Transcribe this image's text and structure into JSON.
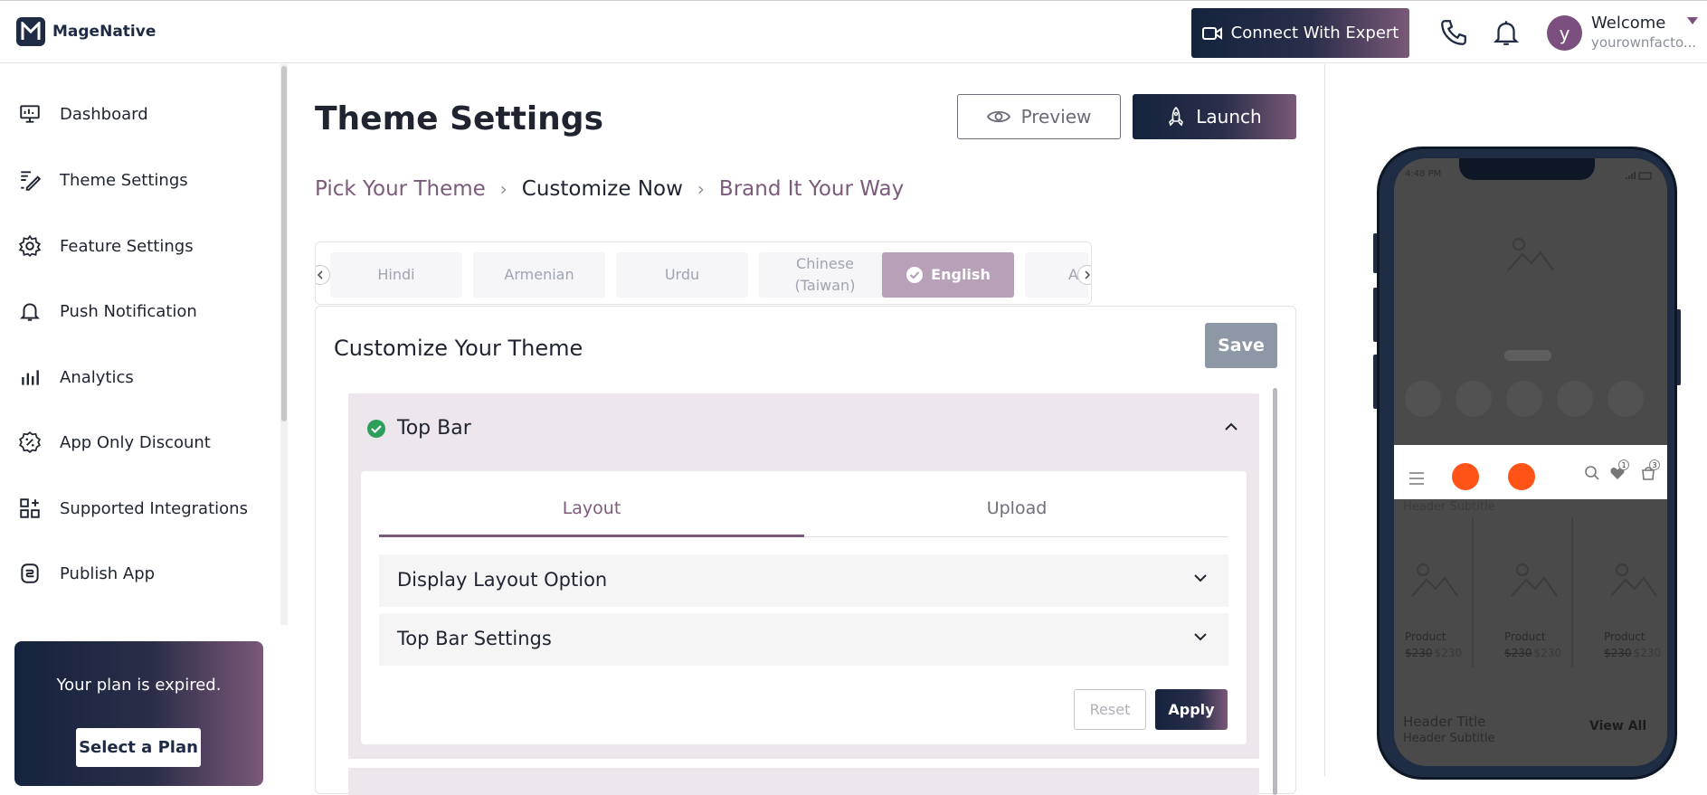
{
  "brand": {
    "name": "MageNative"
  },
  "topbar": {
    "expert_label": "Connect With Expert",
    "welcome": "Welcome",
    "user": "yourownfacto...",
    "avatar_letter": "y"
  },
  "sidebar": {
    "items": [
      {
        "label": "Dashboard",
        "icon": "dashboard-icon"
      },
      {
        "label": "Theme Settings",
        "icon": "theme-icon"
      },
      {
        "label": "Feature Settings",
        "icon": "gear-icon"
      },
      {
        "label": "Push Notification",
        "icon": "bell-icon"
      },
      {
        "label": "Analytics",
        "icon": "analytics-icon"
      },
      {
        "label": "App Only Discount",
        "icon": "discount-icon"
      },
      {
        "label": "Supported Integrations",
        "icon": "integrations-icon"
      },
      {
        "label": "Publish App",
        "icon": "publish-icon"
      }
    ],
    "plan": {
      "text": "Your plan is expired.",
      "button": "Select a Plan"
    }
  },
  "main": {
    "title": "Theme Settings",
    "preview_label": "Preview",
    "launch_label": "Launch",
    "breadcrumb": [
      "Pick Your Theme",
      "Customize Now",
      "Brand It Your Way"
    ],
    "languages": [
      "Hindi",
      "Armenian",
      "Urdu",
      "Chinese (Taiwan)",
      "English",
      "A"
    ],
    "active_language": "English",
    "panel": {
      "title": "Customize Your Theme",
      "save_label": "Save",
      "accordion": {
        "title": "Top Bar",
        "tabs": [
          "Layout",
          "Upload"
        ],
        "active_tab": "Layout",
        "sections": [
          "Display Layout Option",
          "Top Bar Settings"
        ],
        "reset_label": "Reset",
        "apply_label": "Apply"
      }
    }
  },
  "preview": {
    "status_time": "4:48 PM",
    "header_subtitle": "Header Subtitle",
    "products": [
      {
        "name": "Product",
        "old_price": "$230",
        "price": "$230"
      },
      {
        "name": "Product",
        "old_price": "$230",
        "price": "$230"
      },
      {
        "name": "Product",
        "old_price": "$230",
        "price": "$230"
      }
    ],
    "header_title": "Header Title",
    "header_subtitle_2": "Header Subtitle",
    "view_all": "View All",
    "wishlist_count": "1",
    "cart_count": "3"
  },
  "colors": {
    "accent": "#7c5a7b",
    "dark": "#14233d",
    "orange": "#ff5317"
  }
}
